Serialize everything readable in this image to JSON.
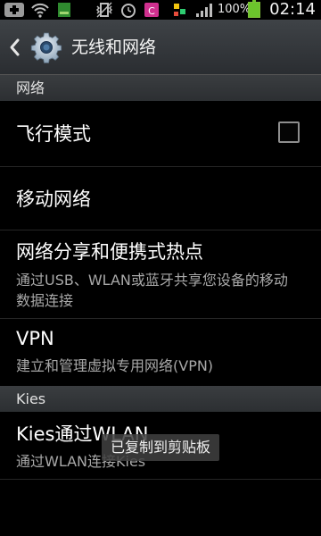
{
  "status_bar": {
    "battery_percent": "100%",
    "time": "02:14",
    "icons": [
      "add-icon",
      "wifi-icon",
      "sim-card-icon",
      "vibrate-icon",
      "alarm-icon",
      "app-notification-icon",
      "usb-icon",
      "signal-icon"
    ],
    "battery_level": 1.0,
    "battery_color": "#6cc52c"
  },
  "action_bar": {
    "title": "无线和网络",
    "back_icon": "chevron-left-icon",
    "app_icon": "gear-icon"
  },
  "sections": [
    {
      "header": "网络",
      "items": [
        {
          "title": "飞行模式",
          "summary": "",
          "checkbox": false
        },
        {
          "title": "移动网络",
          "summary": ""
        },
        {
          "title": "网络分享和便携式热点",
          "summary": "通过USB、WLAN或蓝牙共享您设备的移动数据连接"
        },
        {
          "title": "VPN",
          "summary": "建立和管理虚拟专用网络(VPN)"
        }
      ]
    },
    {
      "header": "Kies",
      "items": [
        {
          "title": "Kies通过WLAN",
          "summary": "通过WLAN连接Kies"
        }
      ]
    }
  ],
  "toast": {
    "text": "已复制到剪贴板"
  },
  "colors": {
    "background": "#000000",
    "header_bg": "#34373a",
    "summary_text": "#a8a8a8"
  }
}
